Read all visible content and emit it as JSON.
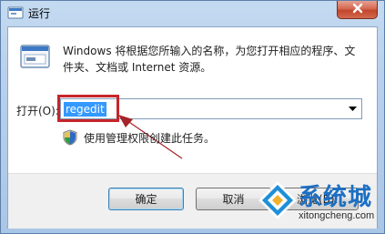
{
  "window": {
    "title": "运行",
    "close_glyph": "✕"
  },
  "dialog": {
    "description": "Windows 将根据您所输入的名称，为您打开相应的程序、文件夹、文档或 Internet 资源。",
    "open_label": "打开(O):",
    "command_value": "regedit",
    "admin_note": "使用管理权限创建此任务。",
    "annotation_color": "#c6252a"
  },
  "buttons": {
    "ok": "确定",
    "cancel": "取消",
    "browse": "浏览(B)..."
  },
  "watermark": {
    "brand": "系统城",
    "url": "xitongcheng.com"
  }
}
